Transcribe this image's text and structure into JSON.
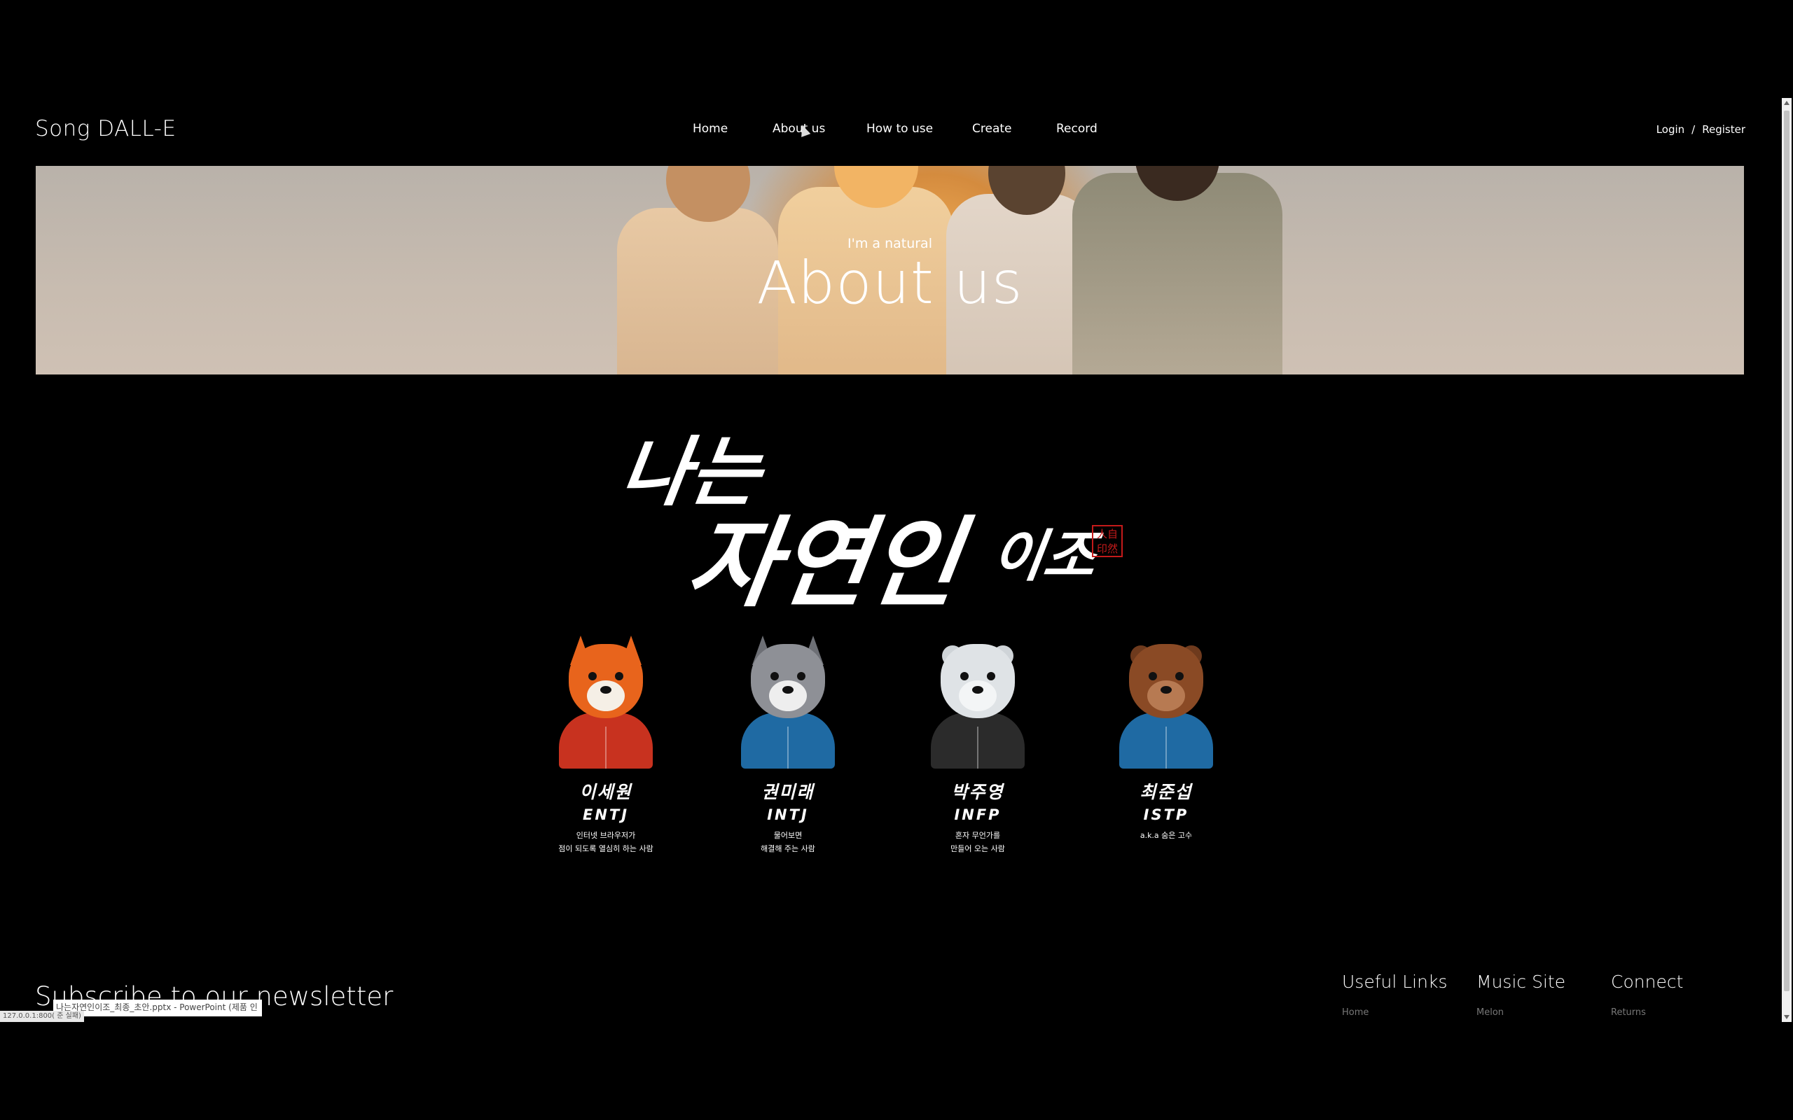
{
  "brand": "Song DALL-E",
  "nav": {
    "items": [
      "Home",
      "About us",
      "How to use",
      "Create",
      "Record"
    ],
    "active": "About us"
  },
  "auth": {
    "login": "Login",
    "separator": "/",
    "register": "Register"
  },
  "hero": {
    "subtitle": "I'm a natural",
    "title": "About us"
  },
  "calligraphy": {
    "line1": "나는",
    "line2": "자연인",
    "line3": "이조",
    "seal": "人自印然",
    "seal_color": "#c41a1a"
  },
  "members": [
    {
      "name": "이세원",
      "mbti": "ENTJ",
      "desc1": "인터넷 브라우저가",
      "desc2": "점이 되도록 열심히 하는 사람",
      "animal": "fox",
      "hoodie": "#c8321f",
      "face": "#e8641c"
    },
    {
      "name": "권미래",
      "mbti": "INTJ",
      "desc1": "물어보면",
      "desc2": "해결해 주는 사람",
      "animal": "husky",
      "hoodie": "#1f6aa3",
      "face": "#8e9096"
    },
    {
      "name": "박주영",
      "mbti": "INFP",
      "desc1": "혼자 무언가를",
      "desc2": "만들어 오는 사람",
      "animal": "polar-bear",
      "hoodie": "#2b2b2b",
      "face": "#dfe3e6"
    },
    {
      "name": "최준섭",
      "mbti": "ISTP",
      "desc1": "a.k.a 숨은 고수",
      "desc2": "",
      "animal": "beaver",
      "hoodie": "#1f6aa3",
      "face": "#8a4a25"
    }
  ],
  "footer": {
    "newsletter": "Subscribe to our newsletter",
    "columns": [
      {
        "heading": "Useful Links",
        "link": "Home"
      },
      {
        "heading": "Music Site",
        "link": "Melon"
      },
      {
        "heading": "Connect",
        "link": "Returns"
      }
    ]
  },
  "status": {
    "tooltip": "나는자연인이조_최종_초안.pptx - PowerPoint (제품 인",
    "url": "127.0.0.1:800( 준 실패)"
  }
}
